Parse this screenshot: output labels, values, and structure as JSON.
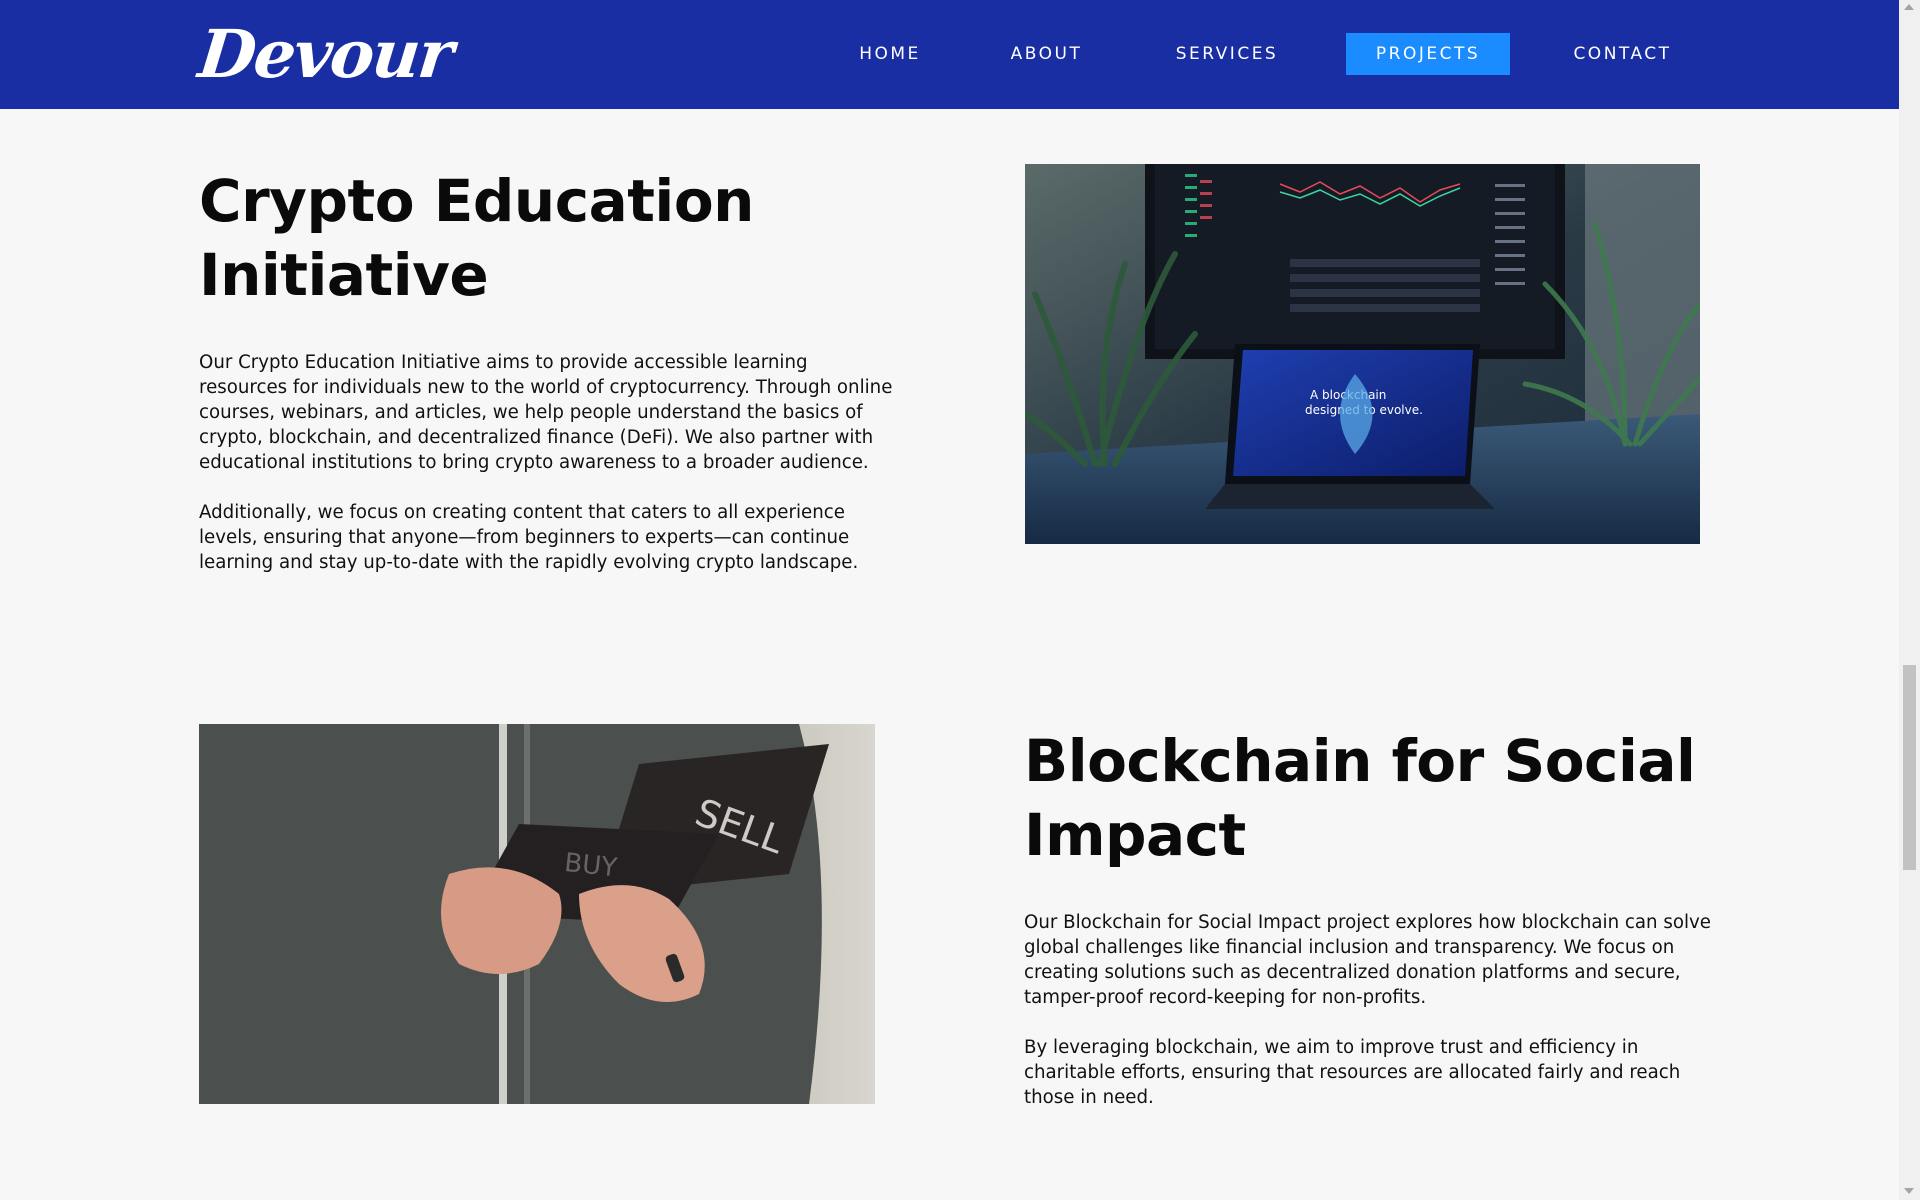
{
  "header": {
    "logo_text": "Devour",
    "nav": [
      {
        "label": "HOME",
        "active": false
      },
      {
        "label": "ABOUT",
        "active": false
      },
      {
        "label": "SERVICES",
        "active": false
      },
      {
        "label": "PROJECTS",
        "active": true
      },
      {
        "label": "CONTACT",
        "active": false
      }
    ]
  },
  "projects": [
    {
      "title_line1": "Crypto Education",
      "title_line2": "Initiative",
      "paragraph1_lines": [
        "Our Crypto Education Initiative aims to provide accessible learning",
        "resources for individuals new to the world of cryptocurrency. Through online",
        "courses, webinars, and articles, we help people understand the basics of",
        "crypto, blockchain, and decentralized finance (DeFi). We also partner with",
        "educational institutions to bring crypto awareness to a broader audience."
      ],
      "paragraph2_lines": [
        "Additionally, we focus on creating content that caters to all experience",
        "levels, ensuring that anyone—from beginners to experts—can continue",
        "learning and stay up-to-date with the rapidly evolving crypto landscape."
      ],
      "image_icon": "laptop-trading-charts-photo"
    },
    {
      "title_line1": "Blockchain for Social",
      "title_line2": "Impact",
      "paragraph1_lines": [
        "Our Blockchain for Social Impact project explores how blockchain can solve",
        "global challenges like financial inclusion and transparency. We focus on",
        "creating solutions such as decentralized donation platforms and secure,",
        "tamper-proof record-keeping for non-profits."
      ],
      "paragraph2_lines": [
        "By leveraging blockchain, we aim to improve trust and efficiency in",
        "charitable efforts, ensuring that resources are allocated fairly and reach",
        "those in need."
      ],
      "image_icon": "buy-sell-cards-photo",
      "image_text_buy": "BUY",
      "image_text_sell": "SELL"
    }
  ],
  "photo1_screen": {
    "laptop_line1": "A blockchain",
    "laptop_line2": "designed to evolve."
  },
  "colors": {
    "header_bg": "#1a2ea3",
    "nav_active_bg": "#1a8cff",
    "page_bg": "#f7f7f7",
    "text": "#111111"
  }
}
